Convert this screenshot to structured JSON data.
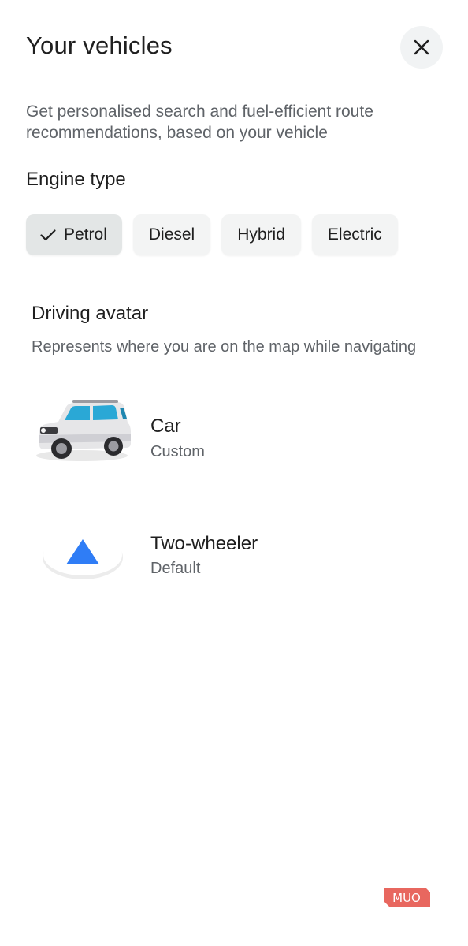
{
  "header": {
    "title": "Your vehicles",
    "close_icon": "close-icon"
  },
  "description": "Get personalised search and fuel-efficient route recommendations, based on your vehicle",
  "engine": {
    "title": "Engine type",
    "options": [
      {
        "label": "Petrol",
        "selected": true
      },
      {
        "label": "Diesel",
        "selected": false
      },
      {
        "label": "Hybrid",
        "selected": false
      },
      {
        "label": "Electric",
        "selected": false
      }
    ]
  },
  "avatar": {
    "title": "Driving avatar",
    "subtitle": "Represents where you are on the map while navigating",
    "items": [
      {
        "name": "Car",
        "detail": "Custom",
        "icon": "car-icon"
      },
      {
        "name": "Two-wheeler",
        "detail": "Default",
        "icon": "navigation-arrow-icon"
      }
    ]
  },
  "watermark": {
    "text": "MUO",
    "color": "#e8675f"
  },
  "colors": {
    "accent_blue": "#2f7df6",
    "chip_selected": "#e3e6e6",
    "chip": "#f3f4f4"
  }
}
